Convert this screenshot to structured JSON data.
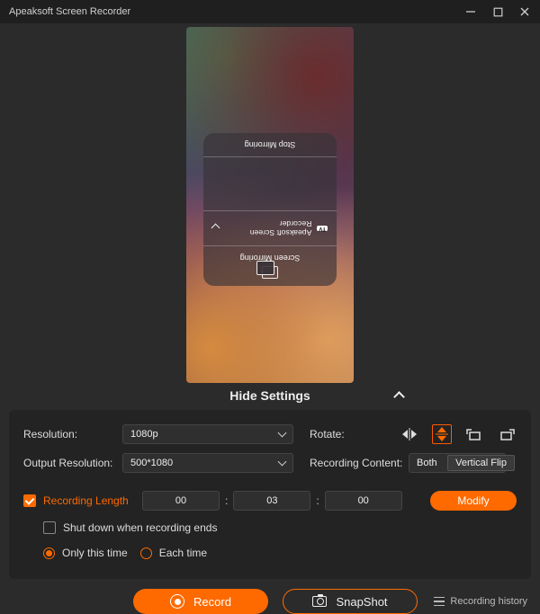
{
  "window": {
    "title": "Apeaksoft Screen Recorder"
  },
  "preview": {
    "panel_title": "Screen Mirroring",
    "entry_tag": "TV",
    "entry_name": "Apeaksoft Screen Recorder",
    "stop_label": "Stop Mirroring"
  },
  "toggle": {
    "hide_settings": "Hide Settings"
  },
  "settings": {
    "resolution": {
      "label": "Resolution:",
      "value": "1080p"
    },
    "output_resolution": {
      "label": "Output Resolution:",
      "value": "500*1080"
    },
    "rotate": {
      "label": "Rotate:",
      "tooltip": "Vertical Flip"
    },
    "recording_content": {
      "label": "Recording Content:",
      "value": "Both"
    },
    "recording_length": {
      "label": "Recording Length",
      "hh": "00",
      "mm": "03",
      "ss": "00",
      "modify": "Modify"
    },
    "shutdown": {
      "label": "Shut down when recording ends"
    },
    "only_this_time": {
      "label": "Only this time"
    },
    "each_time": {
      "label": "Each time"
    }
  },
  "footer": {
    "record": "Record",
    "snapshot": "SnapShot",
    "history": "Recording history"
  }
}
